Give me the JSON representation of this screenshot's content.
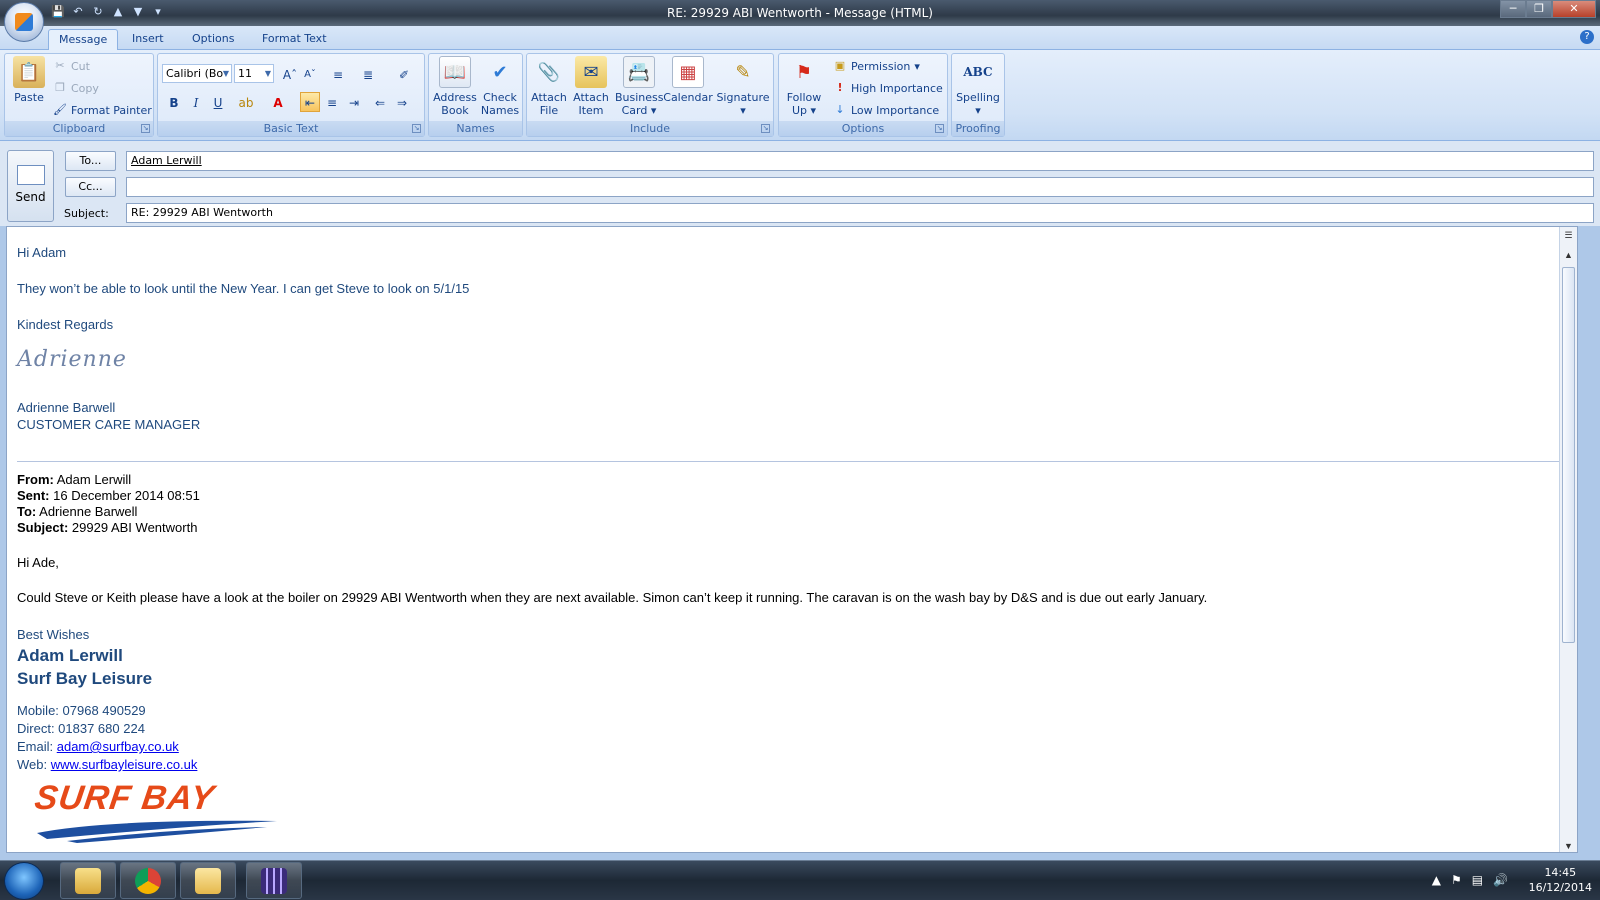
{
  "window": {
    "title": "RE: 29929 ABI Wentworth - Message (HTML)",
    "controls": [
      "minimize-icon",
      "restore-icon",
      "close-icon"
    ]
  },
  "quick_access": [
    "save-icon",
    "undo-icon",
    "redo-icon",
    "previous-icon",
    "next-icon",
    "customize-icon"
  ],
  "tabs": [
    {
      "label": "Message",
      "active": true
    },
    {
      "label": "Insert",
      "active": false
    },
    {
      "label": "Options",
      "active": false
    },
    {
      "label": "Format Text",
      "active": false
    }
  ],
  "ribbon": {
    "clipboard": {
      "label": "Clipboard",
      "paste": "Paste",
      "cut": "Cut",
      "copy": "Copy",
      "format_painter": "Format Painter"
    },
    "basic_text": {
      "label": "Basic Text",
      "font": "Calibri (Bo",
      "size": "11",
      "bold": "B",
      "italic": "I",
      "underline": "U"
    },
    "names": {
      "label": "Names",
      "address_book": [
        "Address",
        "Book"
      ],
      "check_names": [
        "Check",
        "Names"
      ]
    },
    "include": {
      "label": "Include",
      "attach_file": [
        "Attach",
        "File"
      ],
      "attach_item": [
        "Attach",
        "Item"
      ],
      "business_card": [
        "Business",
        "Card"
      ],
      "calendar": "Calendar",
      "signature": "Signature"
    },
    "options": {
      "label": "Options",
      "follow_up": [
        "Follow",
        "Up"
      ],
      "permission": "Permission",
      "high": "High Importance",
      "low": "Low Importance"
    },
    "proofing": {
      "label": "Proofing",
      "spelling": "Spelling",
      "spelling_icon_text": "ABC"
    }
  },
  "header": {
    "send": "Send",
    "to_btn": "To...",
    "cc_btn": "Cc...",
    "subject_label": "Subject:",
    "to_value": "Adam Lerwill",
    "cc_value": "",
    "subject_value": "RE: 29929 ABI Wentworth"
  },
  "body": {
    "greeting": "Hi Adam",
    "line1": "They won’t be able to look until the New Year.  I can get Steve to look on 5/1/15",
    "regards": "Kindest Regards",
    "signature_script": "Adrienne",
    "sender_name": "Adrienne Barwell",
    "sender_title": "CUSTOMER CARE MANAGER",
    "orig": {
      "from_label": "From:",
      "from": "Adam Lerwill",
      "sent_label": "Sent:",
      "sent": "16 December 2014 08:51",
      "to_label": "To:",
      "to": "Adrienne Barwell",
      "subject_label": "Subject:",
      "subject": "29929 ABI Wentworth",
      "greeting": "Hi Ade,",
      "text": "Could Steve or Keith please have a look at the boiler on 29929 ABI Wentworth when they are next available.  Simon can’t keep it running.  The caravan is on the wash bay by D&S and is due out early January.",
      "wishes": "Best Wishes",
      "name": "Adam Lerwill",
      "company": "Surf Bay Leisure",
      "mobile": "Mobile: 07968 490529",
      "direct": "Direct:  01837 680 224",
      "email_label": "Email: ",
      "email": "adam@surfbay.co.uk",
      "web_label": "Web: ",
      "web": "www.surfbayleisure.co.uk",
      "logo_text": "SURF BAY"
    }
  },
  "taskbar": {
    "apps": [
      "explorer-icon",
      "chrome-icon",
      "outlook-icon",
      "calculator-icon"
    ],
    "time": "14:45",
    "date": "16/12/2014"
  }
}
